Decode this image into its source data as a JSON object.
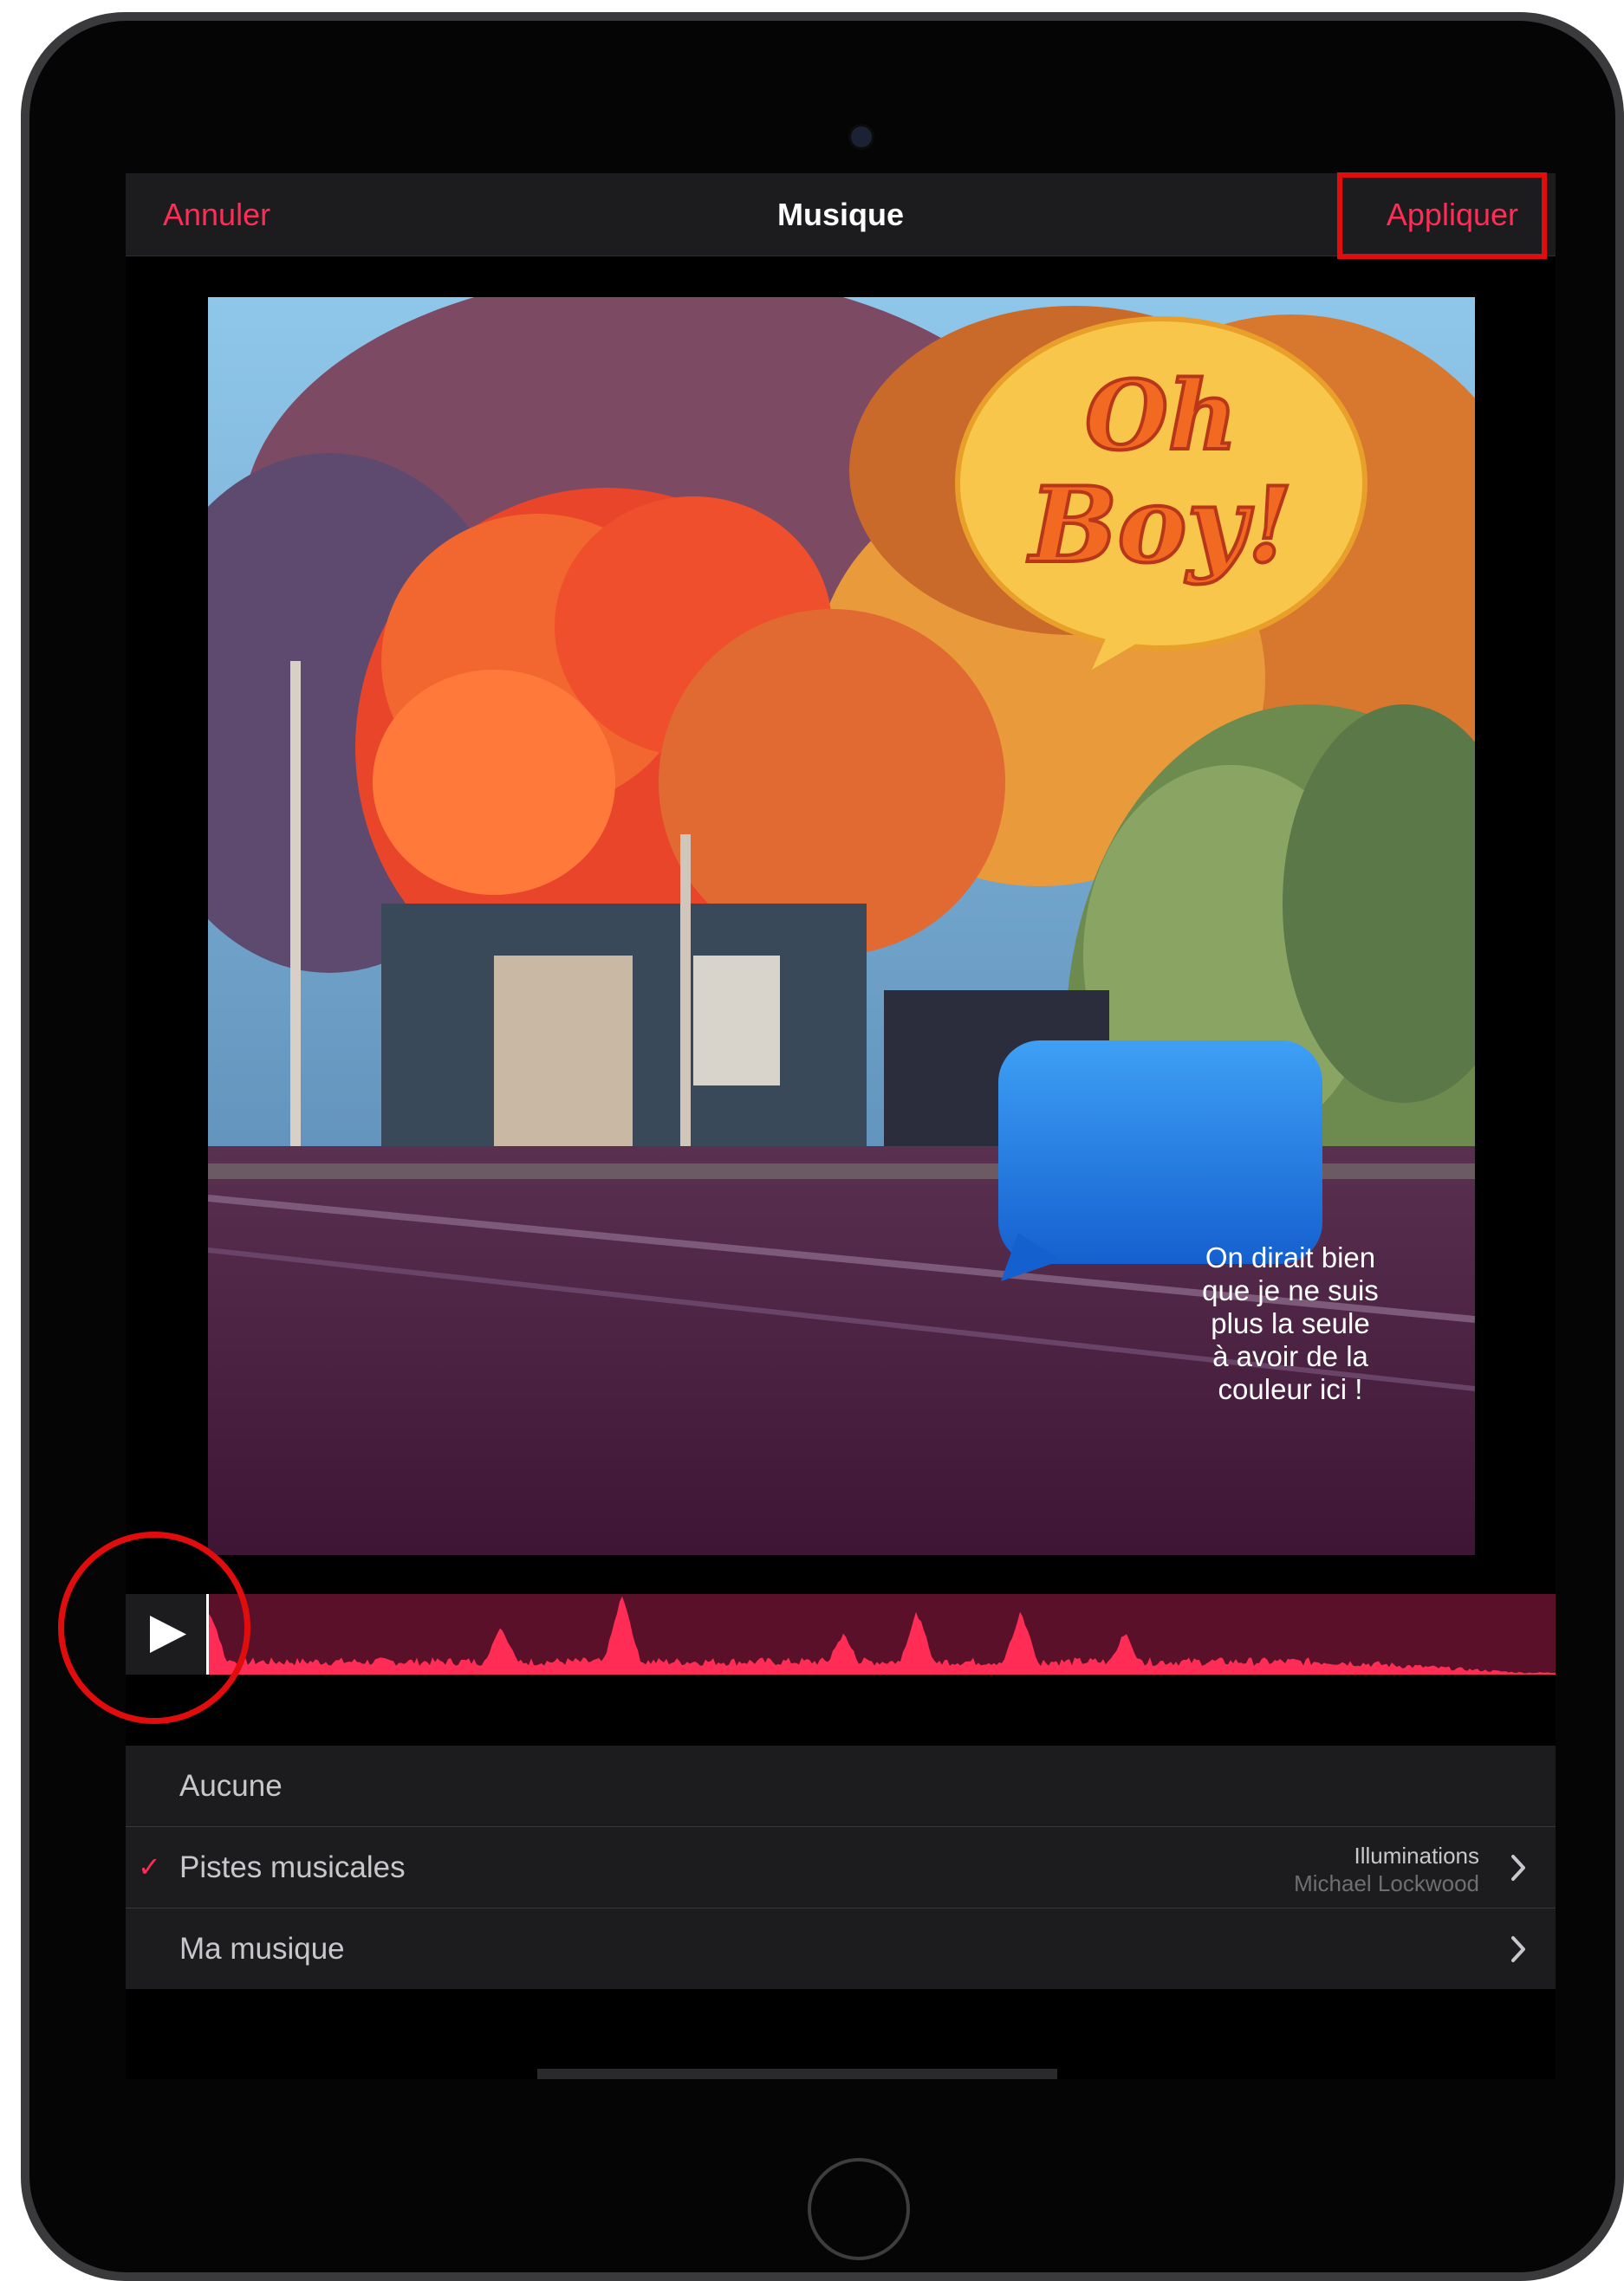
{
  "nav": {
    "cancel_label": "Annuler",
    "title": "Musique",
    "apply_label": "Appliquer"
  },
  "canvas": {
    "sticker_text": "Oh Boy!",
    "speech_bubble_lines": [
      "On dirait bien",
      "que je ne suis",
      "plus la seule",
      "à avoir de la",
      "couleur ici !"
    ]
  },
  "player": {
    "play_icon": "play-icon",
    "waveform_color": "#ff2d55"
  },
  "music_list": {
    "items": [
      {
        "label": "Aucune",
        "selected": false,
        "has_chevron": false
      },
      {
        "label": "Pistes musicales",
        "selected": true,
        "check_icon": "checkmark-icon",
        "detail_title": "Illuminations",
        "detail_subtitle": "Michael Lockwood",
        "has_chevron": true
      },
      {
        "label": "Ma musique",
        "selected": false,
        "has_chevron": true
      }
    ]
  },
  "colors": {
    "accent": "#ff2d55",
    "annotation": "#e10d0d",
    "background": "#000000"
  }
}
